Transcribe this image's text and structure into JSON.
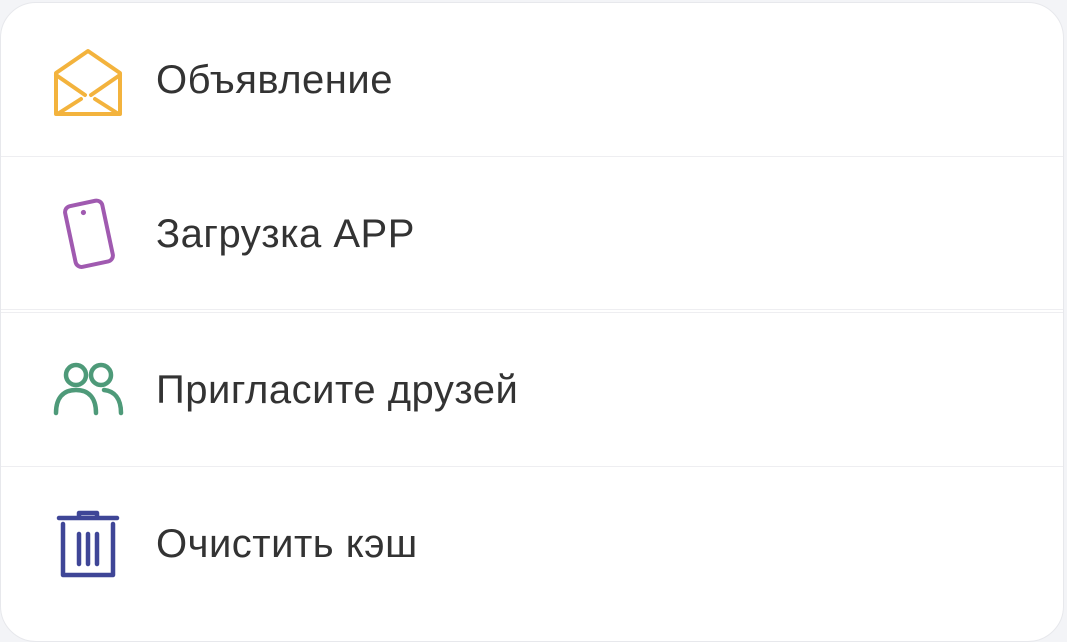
{
  "menu": {
    "items": [
      {
        "label": "Объявление",
        "icon": "envelope-open-icon",
        "color": "#f3b33d"
      },
      {
        "label": "Загрузка APP",
        "icon": "phone-icon",
        "color": "#a05ab0"
      },
      {
        "label": "Пригласите друзей",
        "icon": "users-icon",
        "color": "#4e9a79"
      },
      {
        "label": "Очистить кэш",
        "icon": "trash-icon",
        "color": "#3f4697"
      }
    ]
  }
}
